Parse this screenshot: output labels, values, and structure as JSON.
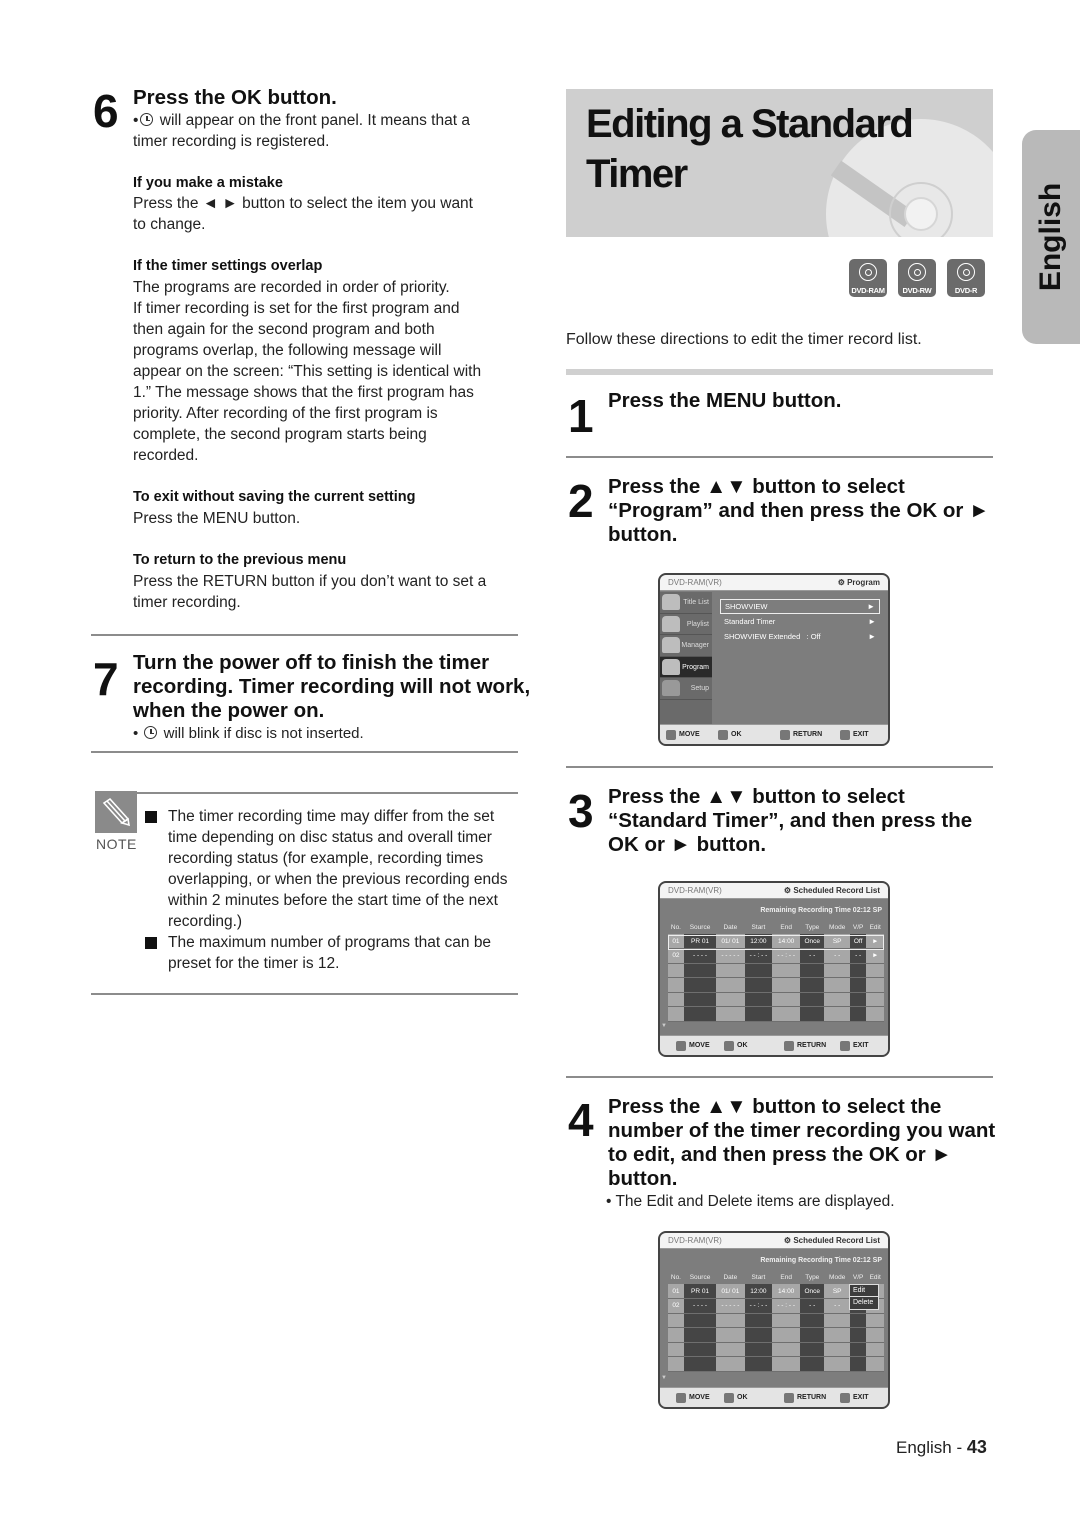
{
  "left": {
    "step6": {
      "number": "6",
      "title": "Press the OK button.",
      "bullet_pre": "•",
      "bullet_text": " will appear on the front panel. It means that a",
      "bullet_text2": "timer recording is registered.",
      "mistake_head": "If you make a mistake",
      "mistake_line1": "Press the ◄ ► button to select the item you want",
      "mistake_line2": "to change.",
      "overlap_head": "If the timer settings overlap",
      "overlap_lines": [
        "The programs are recorded in order of priority.",
        "If timer recording is set for the first program and",
        "then again for the second program and both",
        "programs overlap, the following message will",
        "appear on the screen: “This setting is identical with",
        "1.” The message shows that the first program has",
        "priority. After recording of the first program is",
        "complete, the second program starts being",
        "recorded."
      ],
      "exit_head": "To exit without saving the current setting",
      "exit_text": "Press the MENU button.",
      "return_head": "To return to the previous menu",
      "return_line1": "Press the RETURN button if you don’t want to set a",
      "return_line2": "timer recording."
    },
    "step7": {
      "number": "7",
      "title_lines": [
        "Turn the power off to finish the timer",
        "recording. Timer recording will not work,",
        "when the power on."
      ],
      "bullet_pre": "•",
      "bullet_text": " will blink if disc is not inserted."
    },
    "note": {
      "label": "NOTE",
      "items": [
        [
          "The timer recording time may differ from the set",
          "time depending on disc status and overall timer",
          "recording status (for example, recording times",
          "overlapping, or when the previous recording ends",
          "within 2 minutes before the start time of the next",
          "recording.)"
        ],
        [
          "The maximum number of programs that can be",
          "preset for the timer is 12."
        ]
      ]
    }
  },
  "right": {
    "banner_title_line1": "Editing a Standard",
    "banner_title_line2": "Timer",
    "badges": [
      "DVD-RAM",
      "DVD-RW",
      "DVD-R"
    ],
    "intro": "Follow these directions to edit the timer record list.",
    "step1": {
      "number": "1",
      "title": "Press the MENU button."
    },
    "step2": {
      "number": "2",
      "title_lines": [
        "Press the ▲▼ button to select",
        "“Program” and then press the OK or ►",
        "button."
      ]
    },
    "step3": {
      "number": "3",
      "title_lines": [
        "Press the ▲▼ button to select",
        "“Standard Timer”, and then press the",
        "OK or ► button."
      ]
    },
    "step4": {
      "number": "4",
      "title_lines": [
        "Press the ▲▼ button to select the",
        "number of the timer recording you want",
        "to edit, and then press the OK or ►",
        "button."
      ],
      "bullet": "• The Edit and Delete items are displayed."
    }
  },
  "osd_program": {
    "disc": "DVD-RAM(VR)",
    "section": "⚙ Program",
    "side_menu": [
      "Title List",
      "Playlist",
      "Manager",
      "Program",
      "Setup"
    ],
    "selected_side": "Program",
    "items": [
      {
        "label": "SHOWVIEW",
        "value": "",
        "arrow": "►"
      },
      {
        "label": "Standard Timer",
        "value": "",
        "arrow": "►"
      },
      {
        "label": "SHOWVIEW Extended",
        "value": ": Off",
        "arrow": "►"
      }
    ],
    "footer": [
      "MOVE",
      "OK",
      "RETURN",
      "EXIT"
    ]
  },
  "osd_list": {
    "disc": "DVD-RAM(VR)",
    "section": "⚙ Scheduled Record List",
    "remaining": "Remaining Recording Time 02:12 SP",
    "columns": [
      "No.",
      "Source",
      "Date",
      "Start",
      "End",
      "Type",
      "Mode",
      "V/P",
      "Edit"
    ],
    "rows": [
      [
        "01",
        "PR  01",
        "01/ 01",
        "12:00",
        "14:00",
        "Once",
        "SP",
        "Off",
        "►"
      ],
      [
        "02",
        "- - - -",
        "- - - - -",
        "- - : - -",
        "- - : - -",
        "- -",
        "- -",
        "- -",
        "►"
      ],
      [
        "",
        "",
        "",
        "",
        "",
        "",
        "",
        "",
        ""
      ],
      [
        "",
        "",
        "",
        "",
        "",
        "",
        "",
        "",
        ""
      ],
      [
        "",
        "",
        "",
        "",
        "",
        "",
        "",
        "",
        ""
      ],
      [
        "",
        "",
        "",
        "",
        "",
        "",
        "",
        "",
        ""
      ]
    ],
    "footer": [
      "MOVE",
      "OK",
      "RETURN",
      "EXIT"
    ]
  },
  "osd_edit": {
    "disc": "DVD-RAM(VR)",
    "section": "⚙ Scheduled Record List",
    "remaining": "Remaining Recording Time 02:12 SP",
    "columns": [
      "No.",
      "Source",
      "Date",
      "Start",
      "End",
      "Type",
      "Mode",
      "V/P",
      "Edit"
    ],
    "rows": [
      [
        "01",
        "PR  01",
        "01/ 01",
        "12:00",
        "14:00",
        "Once",
        "SP",
        "",
        ""
      ],
      [
        "02",
        "- - - -",
        "- - - - -",
        "- - : - -",
        "- - : - -",
        "- -",
        "- -",
        "",
        ""
      ],
      [
        "",
        "",
        "",
        "",
        "",
        "",
        "",
        "",
        ""
      ],
      [
        "",
        "",
        "",
        "",
        "",
        "",
        "",
        "",
        ""
      ],
      [
        "",
        "",
        "",
        "",
        "",
        "",
        "",
        "",
        ""
      ],
      [
        "",
        "",
        "",
        "",
        "",
        "",
        "",
        "",
        ""
      ]
    ],
    "popup": [
      "Edit",
      "Delete"
    ],
    "footer": [
      "MOVE",
      "OK",
      "RETURN",
      "EXIT"
    ]
  },
  "side_tab": "English",
  "footer": {
    "lang": "English - ",
    "page": "43"
  }
}
